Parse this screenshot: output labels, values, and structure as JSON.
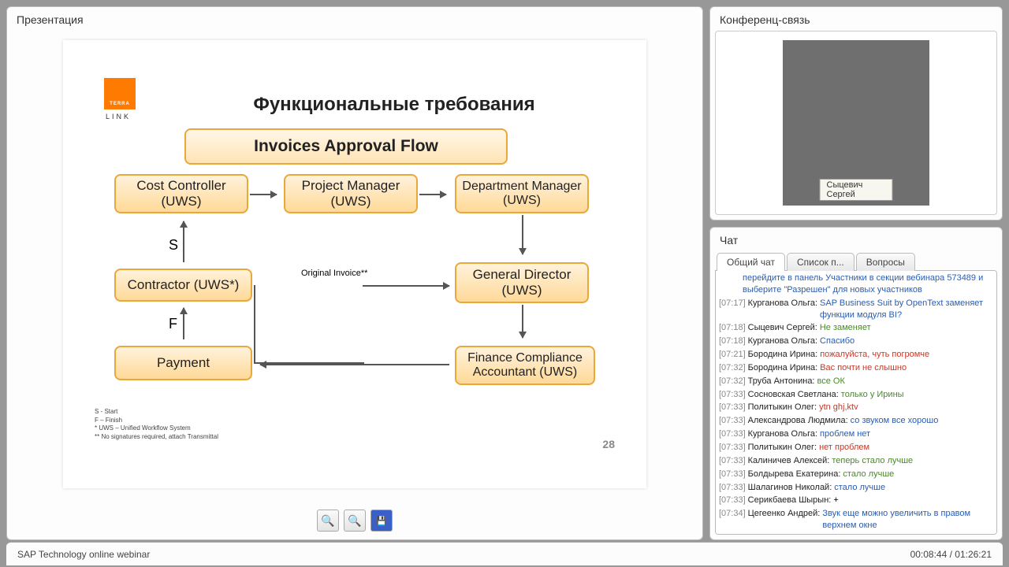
{
  "presentation": {
    "panel_title": "Презентация",
    "slide_title": "Функциональные требования",
    "header_box": "Invoices Approval Flow",
    "nodes": {
      "cost_controller": "Cost Controller (UWS)",
      "project_manager": "Project Manager (UWS)",
      "department_manager": "Department Manager (UWS)",
      "contractor": "Contractor (UWS*)",
      "general_director": "General Director (UWS)",
      "payment": "Payment",
      "finance_compliance": "Finance Compliance Accountant (UWS)"
    },
    "labels": {
      "s": "S",
      "f": "F",
      "original_invoice": "Original Invoice**"
    },
    "footnote": "S - Start\nF – Finish\n* UWS – Unified Workflow System\n** No signatures required, attach Transmittal",
    "logo_word": "TERRA",
    "logo_suffix": "LINK",
    "page_number": "28",
    "toolbar": {
      "zoom_in": "zoom-in",
      "zoom_out": "zoom-out",
      "save": "save"
    }
  },
  "conference": {
    "panel_title": "Конференц-связь",
    "presenter_name": "Сыцевич Сергей"
  },
  "chat": {
    "panel_title": "Чат",
    "tabs": [
      "Общий чат",
      "Список п...",
      "Вопросы"
    ],
    "system_msg": "перейдите в панель Участники в секции вебинара 573489 и выберите \"Разрешен\" для новых участников",
    "messages": [
      {
        "time": "[07:17]",
        "author": "Курганова Ольга:",
        "text": "SAP Business Suit by OpenText заменяет функции модуля BI?",
        "color": "blue"
      },
      {
        "time": "[07:18]",
        "author": "Сыцевич Сергей:",
        "text": "Не заменяет",
        "color": "green"
      },
      {
        "time": "[07:18]",
        "author": "Курганова Ольга:",
        "text": "Спасибо",
        "color": "blue"
      },
      {
        "time": "[07:21]",
        "author": "Бородина Ирина:",
        "text": "пожалуйста, чуть погромче",
        "color": "red"
      },
      {
        "time": "[07:32]",
        "author": "Бородина Ирина:",
        "text": "Вас почти не слышно",
        "color": "red"
      },
      {
        "time": "[07:32]",
        "author": "Труба Антонина:",
        "text": "все ОК",
        "color": "green"
      },
      {
        "time": "[07:33]",
        "author": "Сосновская Светлана:",
        "text": "только у Ирины",
        "color": "green"
      },
      {
        "time": "[07:33]",
        "author": "Политыкин Олег:",
        "text": "ytn ghj,ktv",
        "color": "red"
      },
      {
        "time": "[07:33]",
        "author": "Александрова Людмила:",
        "text": "со звуком все хорошо",
        "color": "blue"
      },
      {
        "time": "[07:33]",
        "author": "Курганова Ольга:",
        "text": "проблем нет",
        "color": "blue"
      },
      {
        "time": "[07:33]",
        "author": "Политыкин Олег:",
        "text": "нет проблем",
        "color": "red"
      },
      {
        "time": "[07:33]",
        "author": "Калиничев Алексей:",
        "text": "теперь стало лучше",
        "color": "green"
      },
      {
        "time": "[07:33]",
        "author": "Болдырева Екатерина:",
        "text": "стало лучше",
        "color": "green"
      },
      {
        "time": "[07:33]",
        "author": "Шалагинов Николай:",
        "text": "стало лучше",
        "color": "blue"
      },
      {
        "time": "[07:33]",
        "author": "Серикбаева Шырын:",
        "text": "+",
        "color": ""
      },
      {
        "time": "[07:34]",
        "author": "Цегеенко Андрей:",
        "text": "Звук еще можно увеличить в правом верхнем окне",
        "color": "blue"
      }
    ]
  },
  "footer": {
    "title": "SAP Technology online webinar",
    "time": "00:08:44 / 01:26:21"
  }
}
